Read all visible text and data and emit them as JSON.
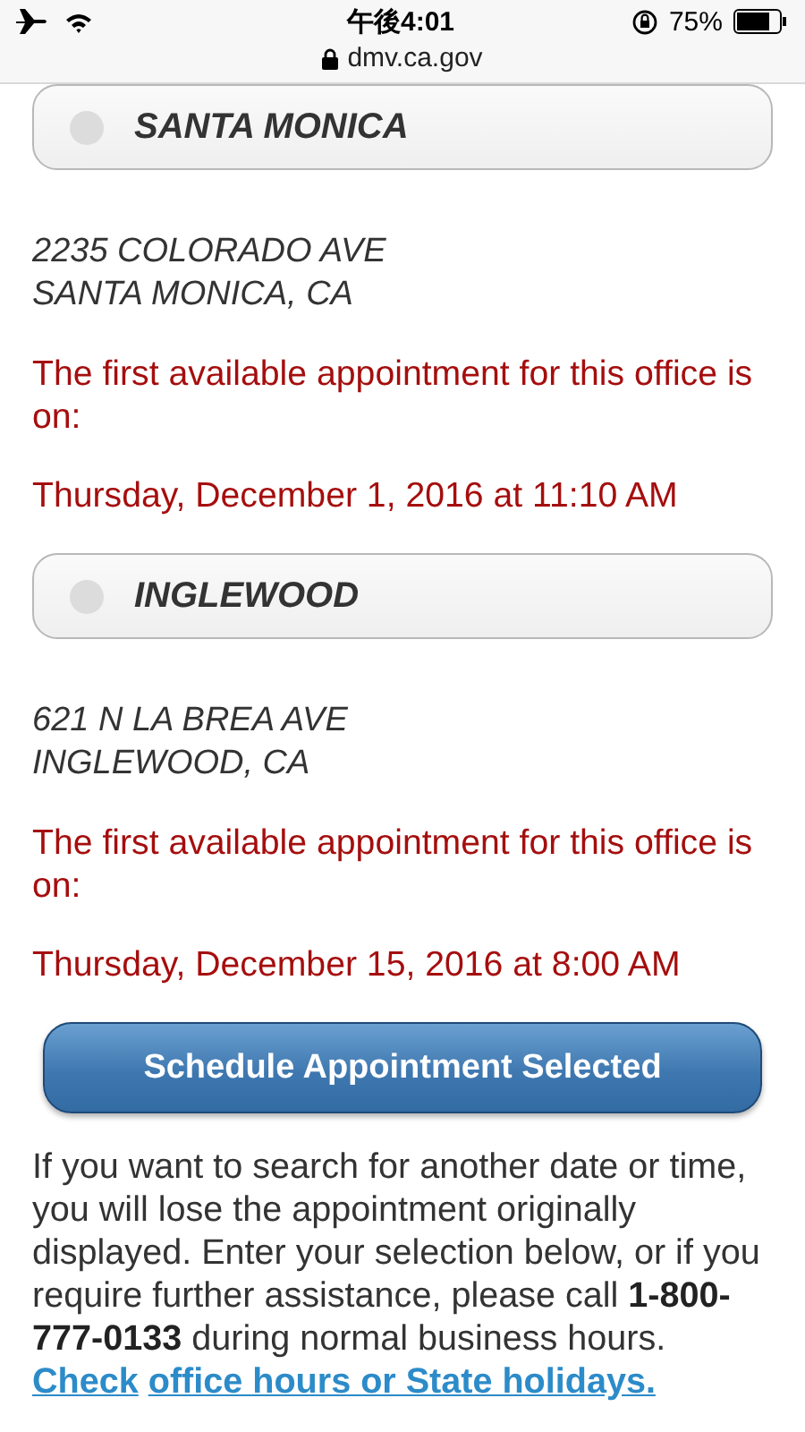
{
  "status_bar": {
    "time": "午後4:01",
    "battery": "75%",
    "url": "dmv.ca.gov"
  },
  "offices": [
    {
      "name": "SANTA MONICA",
      "selected": false,
      "address": [
        "2235 COLORADO AVE",
        "SANTA MONICA, CA"
      ],
      "notice": "The first available appointment for this office is on:",
      "appointment": "Thursday, December 1, 2016 at 11:10 AM"
    },
    {
      "name": "INGLEWOOD",
      "selected": false,
      "address": [
        "621 N LA BREA AVE",
        "INGLEWOOD, CA"
      ],
      "notice": "The first available appointment for this office is on:",
      "appointment": "Thursday, December 15, 2016 at 8:00 AM"
    }
  ],
  "schedule_button": "Schedule Appointment Selected",
  "info": {
    "text": "If you want to search for another date or time, you will lose the appointment originally displayed. Enter your selection below, or if you require further assistance, please call **1-800-777-0133** during normal business hours.",
    "link_lines": [
      "Check",
      "office hours or State holidays."
    ]
  }
}
